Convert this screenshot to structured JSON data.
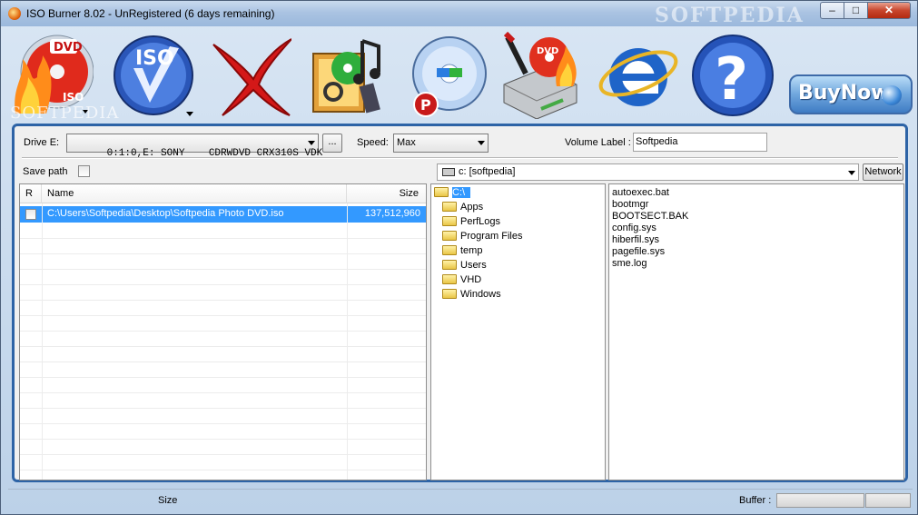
{
  "window": {
    "title": "ISO Burner 8.02 - UnRegistered (6 days remaining)",
    "watermark": "SOFTPEDIA",
    "minimize_glyph": "–",
    "maximize_glyph": "□",
    "close_glyph": "✕"
  },
  "toolbar": {
    "items": [
      {
        "name": "burn-dvd-iso",
        "icon": "dvd-flame-icon"
      },
      {
        "name": "iso",
        "icon": "iso-check-icon",
        "badge": "ISO"
      },
      {
        "name": "cancel",
        "icon": "red-x-icon"
      },
      {
        "name": "media",
        "icon": "media-folder-icon"
      },
      {
        "name": "disc",
        "icon": "disc-p-icon"
      },
      {
        "name": "burn-drive",
        "icon": "drive-flame-icon"
      },
      {
        "name": "internet",
        "icon": "ie-icon"
      },
      {
        "name": "help",
        "icon": "help-icon",
        "badge": "?"
      }
    ],
    "buy_now": "BuyNow",
    "softpedia": "SOFTPEDIA"
  },
  "drive": {
    "label": "Drive E:",
    "value": "0:1:0,E: SONY    CDRWDVD CRX310S VDK",
    "browse": "..."
  },
  "speed": {
    "label": "Speed:",
    "value": "Max"
  },
  "volume": {
    "label": "Volume Label :",
    "value": "Softpedia"
  },
  "save_path": {
    "label": "Save path",
    "checked": false
  },
  "browser": {
    "drive": "c: [softpedia]",
    "network_button": "Network"
  },
  "file_list": {
    "columns": [
      "R",
      "Name",
      "Size"
    ],
    "rows": [
      {
        "checked": false,
        "name": "C:\\Users\\Softpedia\\Desktop\\Softpedia Photo DVD.iso",
        "size": "137,512,960"
      }
    ]
  },
  "tree": {
    "root": "C:\\",
    "folders": [
      "Apps",
      "PerfLogs",
      "Program Files",
      "temp",
      "Users",
      "VHD",
      "Windows"
    ]
  },
  "files": [
    "autoexec.bat",
    "bootmgr",
    "BOOTSECT.BAK",
    "config.sys",
    "hiberfil.sys",
    "pagefile.sys",
    "sme.log"
  ],
  "status": {
    "size_label": "Size",
    "buffer_label": "Buffer :"
  },
  "colors": {
    "frame": "#2d63a6",
    "selection": "#3399ff",
    "close": "#c8452c"
  }
}
